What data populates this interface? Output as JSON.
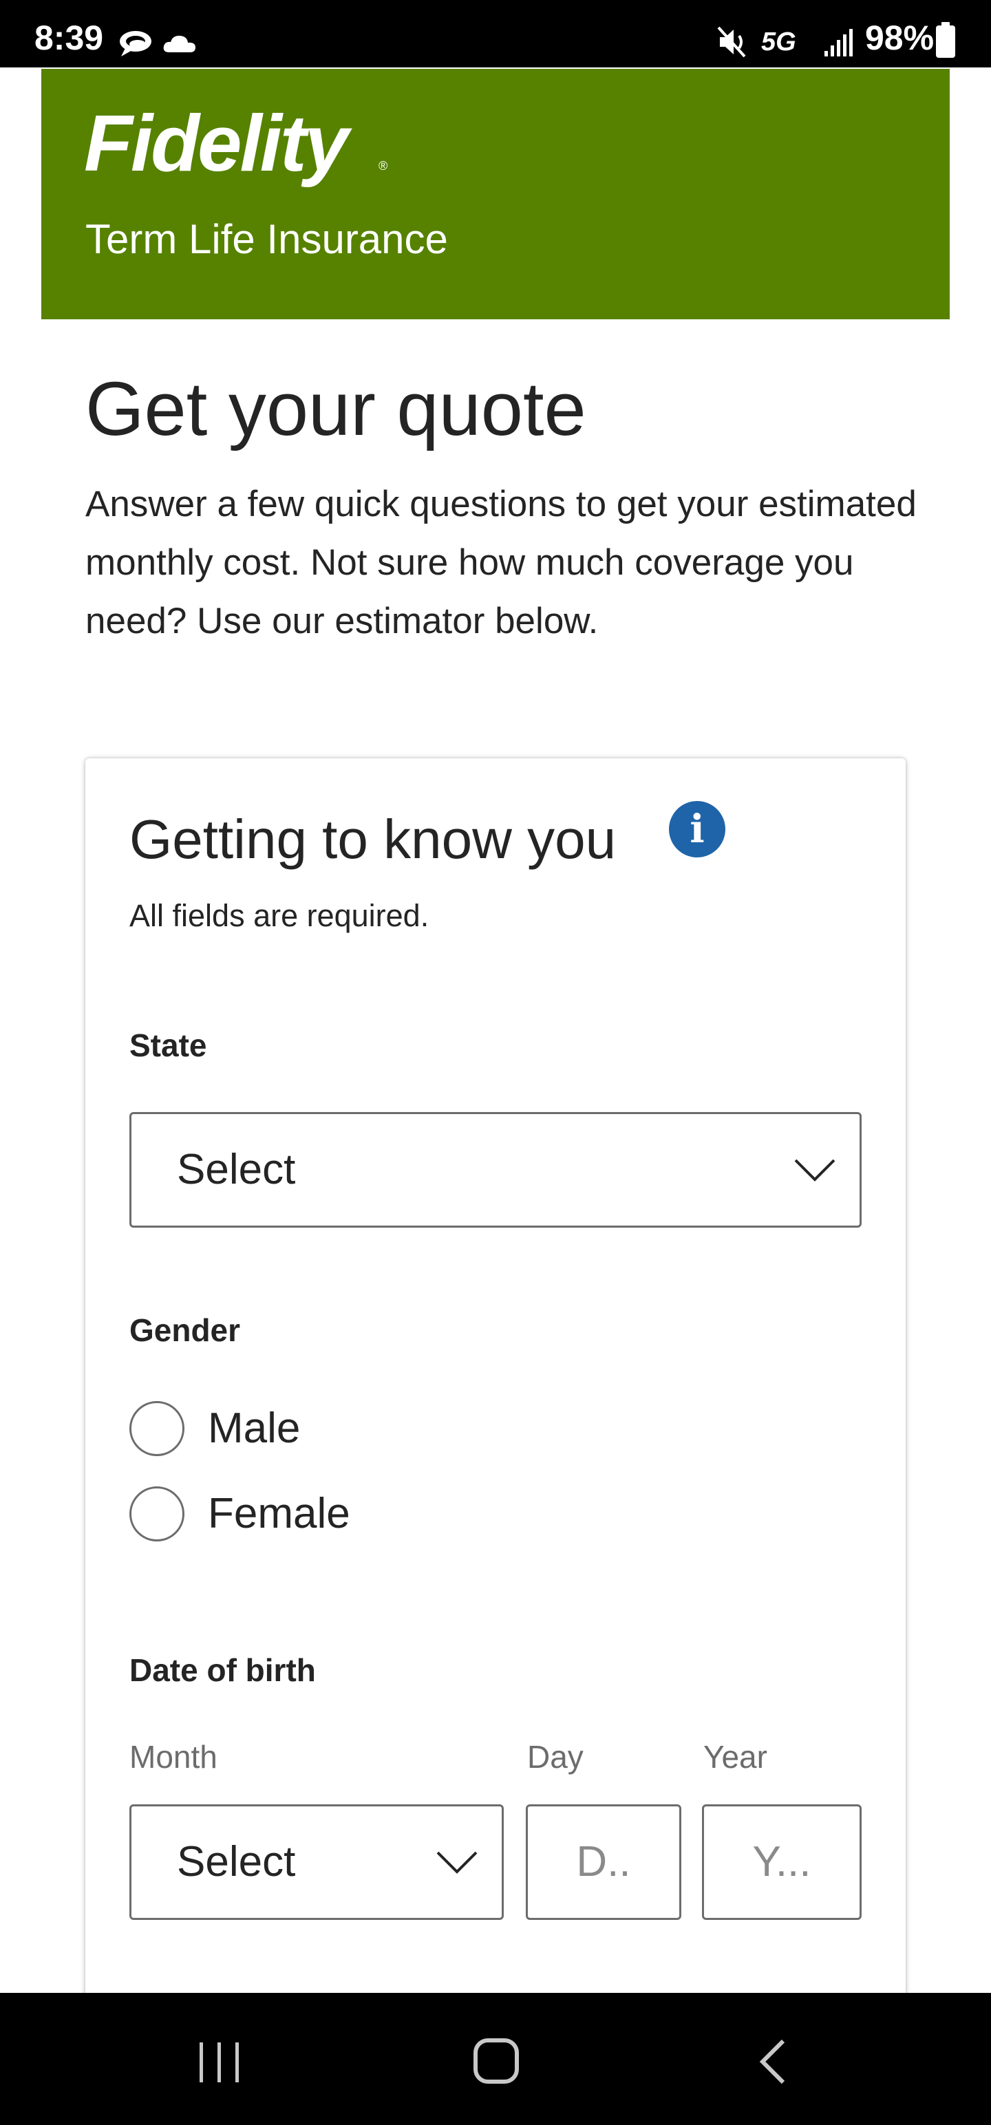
{
  "status_bar": {
    "time": "8:39",
    "network": "5G",
    "battery": "98%",
    "icons": [
      "speech-bubble-icon",
      "cloud-icon",
      "mute-icon",
      "signal-icon",
      "battery-icon"
    ]
  },
  "header": {
    "logo_text": "Fidelity",
    "logo_reg": "®",
    "product": "Term Life Insurance",
    "brand_color": "#568200"
  },
  "intro": {
    "title": "Get your quote",
    "description": "Answer a few quick questions to get your estimated monthly cost. Not sure how much coverage you need? Use our estimator below."
  },
  "card": {
    "title": "Getting to know you",
    "info_icon": "info-icon",
    "info_color": "#1f64a8",
    "note": "All fields are required.",
    "state": {
      "label": "State",
      "value": "Select"
    },
    "gender": {
      "label": "Gender",
      "options": [
        "Male",
        "Female"
      ]
    },
    "dob": {
      "label": "Date of birth",
      "month_label": "Month",
      "month_value": "Select",
      "day_label": "Day",
      "day_placeholder": "D..",
      "year_label": "Year",
      "year_placeholder": "Y..."
    }
  },
  "nav_bar": {
    "buttons": [
      "recent-apps-icon",
      "home-icon",
      "back-icon"
    ]
  }
}
